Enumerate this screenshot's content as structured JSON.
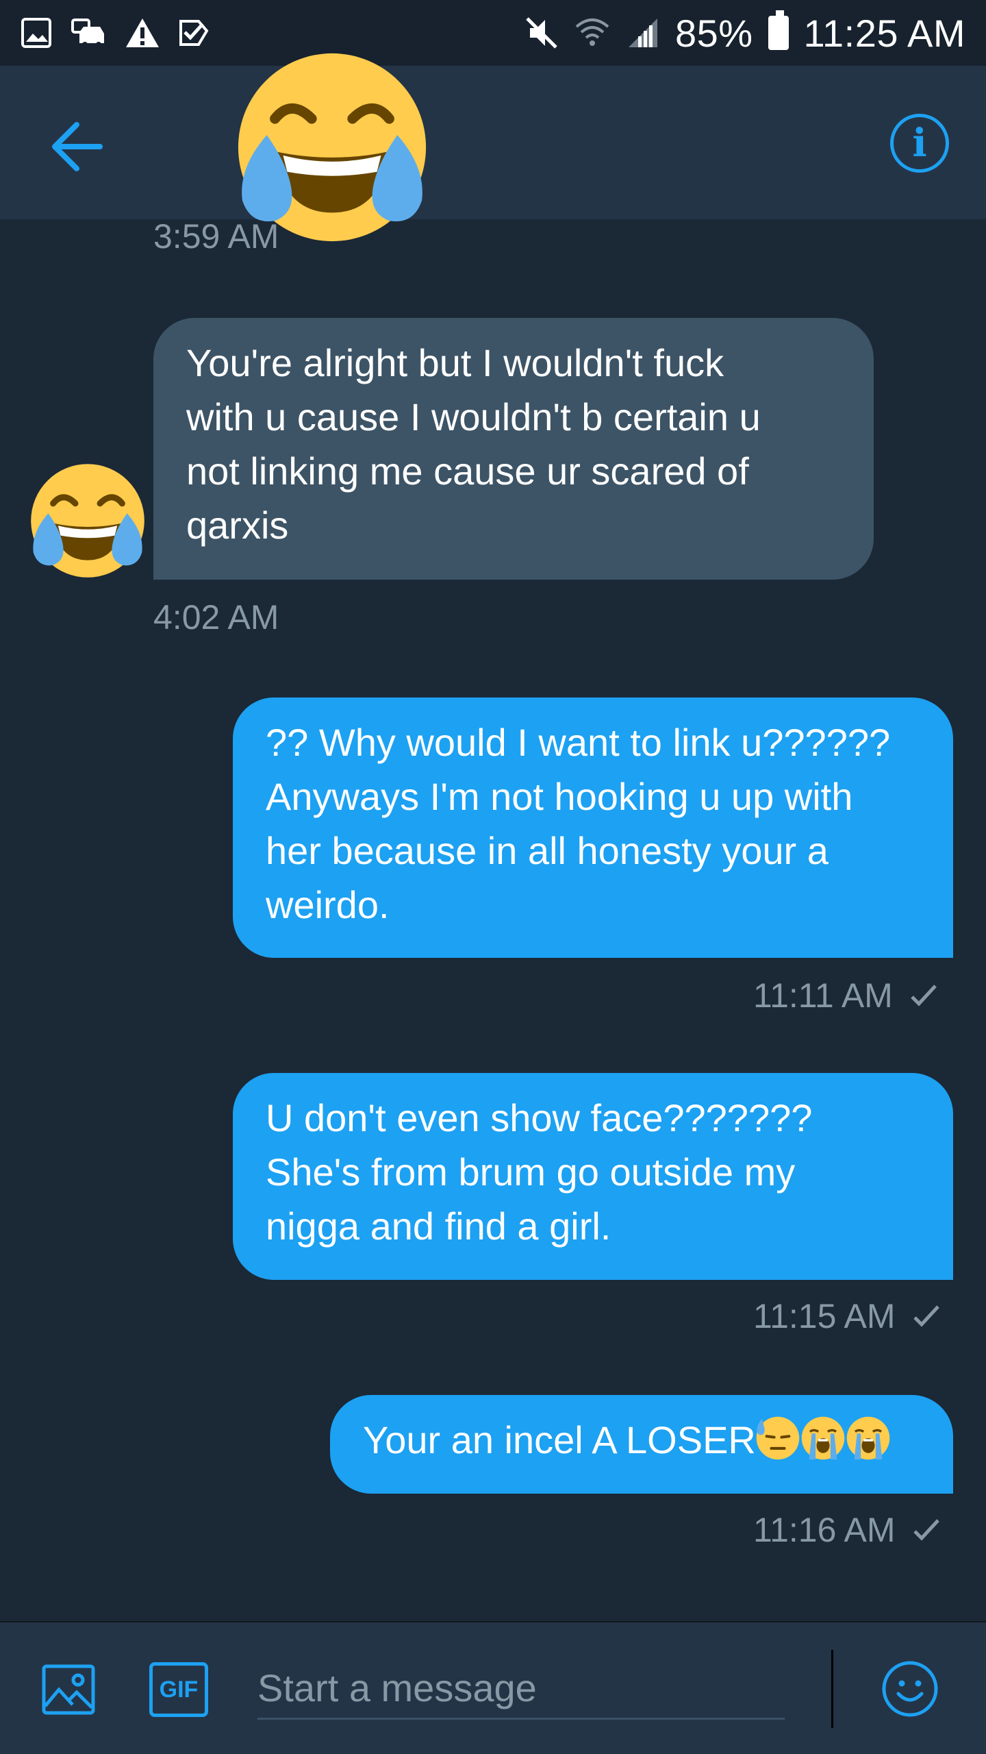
{
  "status_bar": {
    "battery": "85%",
    "time": "11:25 AM",
    "left_icons": [
      "gallery-icon",
      "car-icon",
      "warning-icon",
      "check-box-icon"
    ],
    "right_icons": [
      "mute-icon",
      "wifi-icon",
      "signal-icon",
      "battery-icon"
    ]
  },
  "header": {
    "back_icon": "arrow-left-icon",
    "info_icon": "info-icon",
    "info_label": "i",
    "avatar_icon": "tears-of-joy-emoji-icon"
  },
  "messages": [
    {
      "direction": "received",
      "timestamp": "3:59 AM"
    },
    {
      "direction": "received",
      "lines": [
        "You're alright but I wouldn't fuck",
        "with u cause I wouldn't b certain u",
        "not linking me cause ur scared of",
        "qarxis"
      ],
      "timestamp": "4:02 AM"
    },
    {
      "direction": "sent",
      "lines": [
        "?? Why would I want to link u??????",
        "Anyways I'm not hooking u up with",
        "her because in all honesty your a",
        "weirdo."
      ],
      "timestamp": "11:11 AM"
    },
    {
      "direction": "sent",
      "lines": [
        "U don't even show face???????",
        "She's from brum go outside my",
        "nigga and find a girl."
      ],
      "timestamp": "11:15 AM"
    },
    {
      "direction": "sent",
      "text": "Your an incel A LOSER",
      "emojis": [
        "downcast-sweat-face-icon",
        "loudly-crying-face-icon",
        "loudly-crying-face-icon"
      ],
      "timestamp": "11:16 AM"
    }
  ],
  "composer": {
    "placeholder": "Start a message",
    "gif_label": "GIF",
    "icons": [
      "image-icon",
      "gif-icon",
      "emoji-icon"
    ]
  },
  "colors": {
    "background": "#1b2836",
    "header": "#243447",
    "sent_bubble": "#1da1f2",
    "received_bubble": "#3d5466",
    "accent": "#1da1f2",
    "muted_text": "#8899a6"
  }
}
